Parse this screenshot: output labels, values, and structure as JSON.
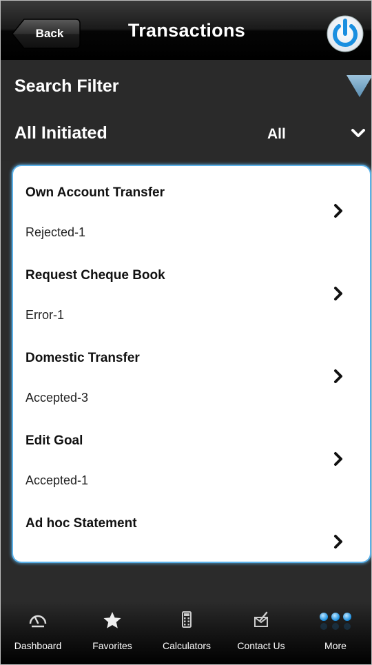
{
  "navbar": {
    "back_label": "Back",
    "title": "Transactions"
  },
  "filter": {
    "search_label": "Search Filter",
    "status_label": "All Initiated",
    "selected_value": "All"
  },
  "transactions": [
    {
      "title": "Own Account Transfer",
      "status": "Rejected-1"
    },
    {
      "title": "Request Cheque Book",
      "status": "Error-1"
    },
    {
      "title": "Domestic Transfer",
      "status": "Accepted-3"
    },
    {
      "title": "Edit Goal",
      "status": "Accepted-1"
    },
    {
      "title": "Ad hoc Statement",
      "status": ""
    }
  ],
  "tabs": [
    {
      "label": "Dashboard",
      "icon": "gauge-icon"
    },
    {
      "label": "Favorites",
      "icon": "star-icon"
    },
    {
      "label": "Calculators",
      "icon": "calculator-icon"
    },
    {
      "label": "Contact Us",
      "icon": "mail-icon"
    },
    {
      "label": "More",
      "icon": "more-dots-icon"
    }
  ],
  "colors": {
    "accent_blue": "#1a8fe0",
    "card_glow": "#5ab0e8",
    "filter_triangle": "#7aa9c8"
  }
}
